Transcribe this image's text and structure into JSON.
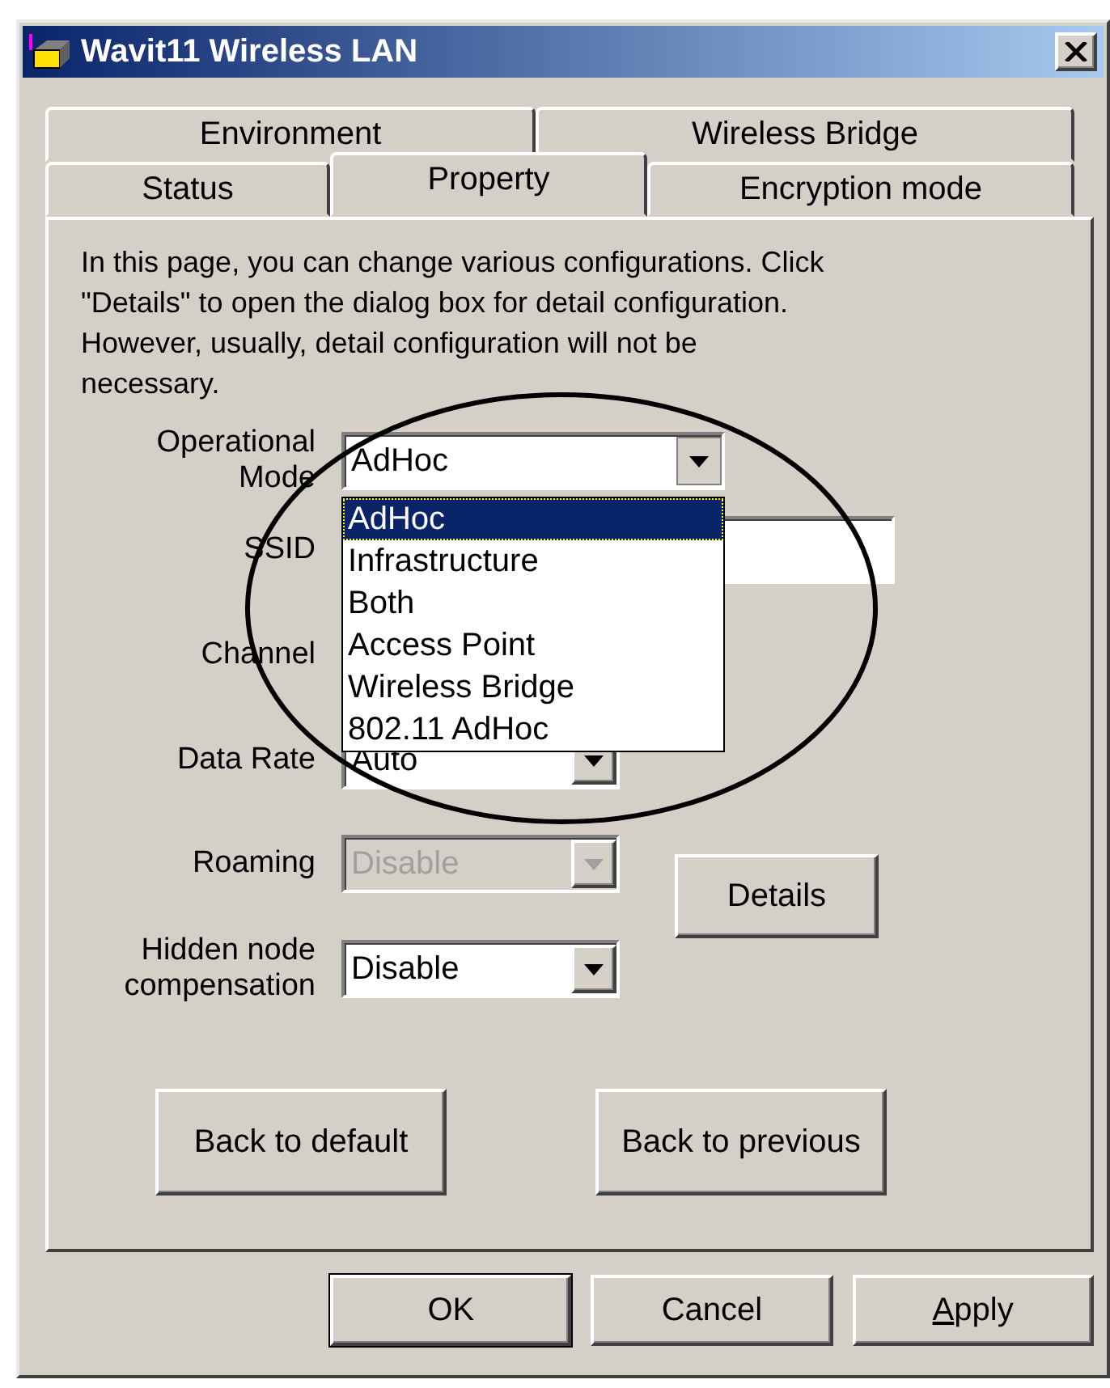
{
  "window": {
    "title": "Wavit11 Wireless LAN"
  },
  "tab_rows": [
    [
      {
        "label": "Environment",
        "selected": false
      },
      {
        "label": "Wireless Bridge",
        "selected": false
      }
    ],
    [
      {
        "label": "Status",
        "selected": false
      },
      {
        "label": "Property",
        "selected": true
      },
      {
        "label": "Encryption mode",
        "selected": false
      }
    ]
  ],
  "intro": "In this page, you can change various configurations. Click \"Details\" to open the dialog box for detail configuration. However, usually, detail configuration will not be necessary.",
  "fields": [
    {
      "kind": "combo",
      "label": "Operational Mode",
      "value": "AdHoc",
      "expanded": true,
      "options": [
        {
          "label": "AdHoc",
          "selected": true
        },
        {
          "label": "Infrastructure",
          "selected": false
        },
        {
          "label": "Both",
          "selected": false
        },
        {
          "label": "Access Point",
          "selected": false
        },
        {
          "label": "Wireless Bridge",
          "selected": false
        },
        {
          "label": "802.11 AdHoc",
          "selected": false
        }
      ]
    },
    {
      "kind": "text",
      "label": "SSID"
    },
    {
      "kind": "covered",
      "label": "Channel"
    },
    {
      "kind": "combo",
      "label": "Data Rate",
      "value": "Auto",
      "expanded": false
    }
  ],
  "lower_fields": [
    {
      "kind": "combo",
      "label": "Roaming",
      "value": "Disable",
      "disabled": true
    },
    {
      "kind": "combo",
      "label": "Hidden node compensation",
      "value": "Disable",
      "disabled": false
    }
  ],
  "details_button": "Details",
  "reset_buttons": [
    "Back to default",
    "Back to previous"
  ],
  "dialog_buttons": [
    {
      "label": "OK",
      "default": true
    },
    {
      "label": "Cancel",
      "default": false
    },
    {
      "label": "Apply",
      "default": false,
      "mnemonic_first": true
    }
  ]
}
